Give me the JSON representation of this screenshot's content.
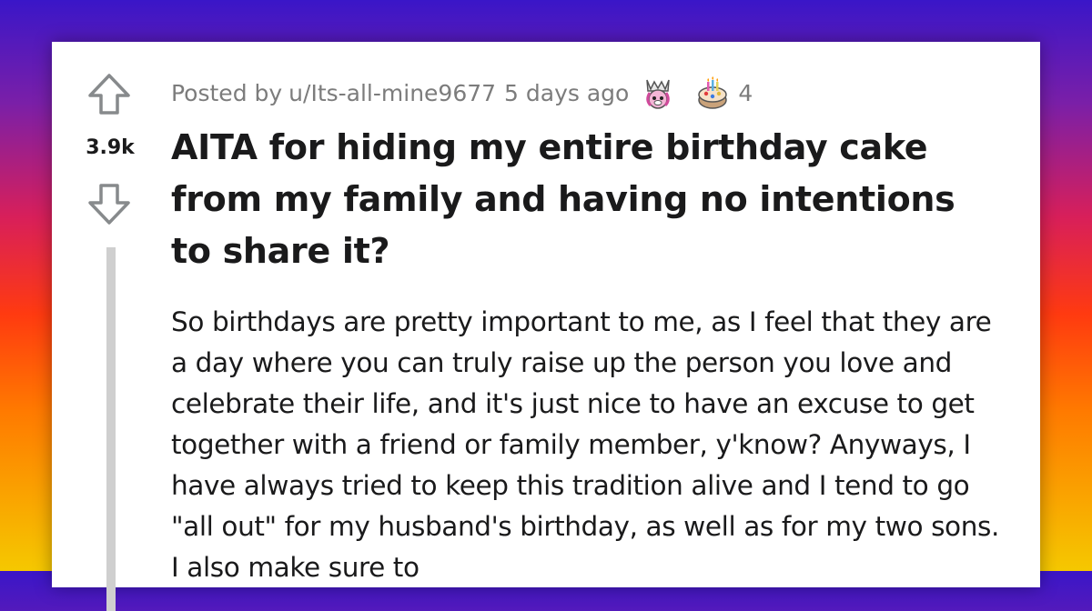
{
  "post": {
    "posted_by_label": "Posted by",
    "username": "u/Its-all-mine9677",
    "time_ago": "5 days ago",
    "awards": [
      {
        "icon": "unicorn-award-icon"
      },
      {
        "icon": "cake-award-icon",
        "count": "4"
      }
    ],
    "score": "3.9k",
    "title": "AITA for hiding my entire birthday cake from my family and having no intentions to share it?",
    "body": "So birthdays are pretty important to me, as I feel that they are a day where you can truly raise up the person you love and celebrate their life, and it's just nice to have an excuse to get together with a friend or family member, y'know? Anyways, I have always tried to keep this tradition alive and I tend to go \"all out\" for my husband's birthday, as well as for my two sons. I also make sure to"
  },
  "colors": {
    "background_top": "#3a16c8",
    "background_bottom": "#f5c800",
    "card": "#ffffff",
    "text": "#1a1a1b",
    "meta_text": "#7c7c7c",
    "thread_line": "#cfcfcf"
  }
}
